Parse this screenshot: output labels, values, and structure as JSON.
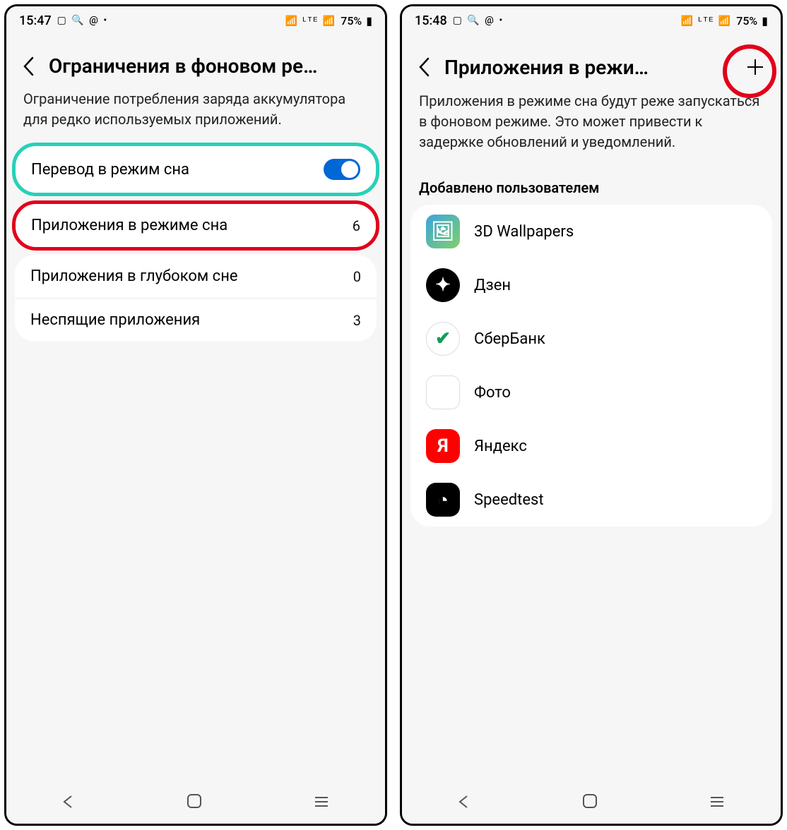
{
  "left": {
    "status": {
      "time": "15:47",
      "battery": "75%"
    },
    "title": "Ограничения в фоновом ре…",
    "description": "Ограничение потребления заряда аккумулятора для редко используемых приложений.",
    "rows": {
      "sleep_toggle": {
        "label": "Перевод в режим сна",
        "on": true
      },
      "sleeping_apps": {
        "label": "Приложения в режиме сна",
        "value": "6"
      },
      "deep_sleep": {
        "label": "Приложения в глубоком сне",
        "value": "0"
      },
      "never_sleep": {
        "label": "Неспящие приложения",
        "value": "3"
      }
    }
  },
  "right": {
    "status": {
      "time": "15:48",
      "battery": "75%"
    },
    "title": "Приложения в режи…",
    "description": "Приложения в режиме сна будут реже запускаться в фоновом режиме. Это может привести к задержке обновлений и уведомлений.",
    "section_header": "Добавлено пользователем",
    "apps": [
      {
        "name": "3D Wallpapers",
        "icon": "wallpapers",
        "glyph": "🖼"
      },
      {
        "name": "Дзен",
        "icon": "dzen",
        "glyph": "✦"
      },
      {
        "name": "СберБанк",
        "icon": "sber",
        "glyph": "✔"
      },
      {
        "name": "Фото",
        "icon": "photo",
        "glyph": "✿"
      },
      {
        "name": "Яндекс",
        "icon": "yandex",
        "glyph": "Я"
      },
      {
        "name": "Speedtest",
        "icon": "speedtest",
        "glyph": "◔"
      }
    ]
  },
  "highlight_colors": {
    "teal": "#27d0b8",
    "red": "#e2001a"
  }
}
